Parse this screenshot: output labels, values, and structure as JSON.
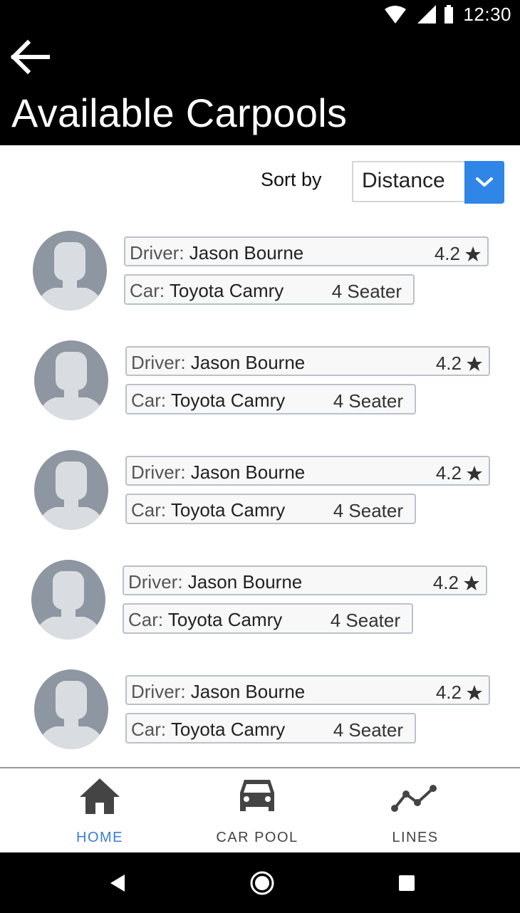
{
  "status_bar": {
    "time": "12:30",
    "icons": [
      "wifi-icon",
      "signal-icon",
      "battery-icon"
    ]
  },
  "app_bar": {
    "back_icon": "arrow-left-icon",
    "title": "Available Carpools"
  },
  "sort": {
    "label": "Sort by",
    "selected": "Distance",
    "accent_color": "#2f86e6"
  },
  "carpools": [
    {
      "driver_label": "Driver:",
      "driver": "Jason Bourne",
      "rating": "4.2",
      "car_label": "Car:",
      "car": "Toyota Camry",
      "seats": "4 Seater"
    },
    {
      "driver_label": "Driver:",
      "driver": "Jason Bourne",
      "rating": "4.2",
      "car_label": "Car:",
      "car": "Toyota Camry",
      "seats": "4 Seater"
    },
    {
      "driver_label": "Driver:",
      "driver": "Jason Bourne",
      "rating": "4.2",
      "car_label": "Car:",
      "car": "Toyota Camry",
      "seats": "4 Seater"
    },
    {
      "driver_label": "Driver:",
      "driver": "Jason Bourne",
      "rating": "4.2",
      "car_label": "Car:",
      "car": "Toyota Camry",
      "seats": "4 Seater"
    },
    {
      "driver_label": "Driver:",
      "driver": "Jason Bourne",
      "rating": "4.2",
      "car_label": "Car:",
      "car": "Toyota Camry",
      "seats": "4 Seater"
    }
  ],
  "bottom_nav": {
    "items": [
      {
        "label": "HOME",
        "icon": "home-icon",
        "active": true
      },
      {
        "label": "CAR POOL",
        "icon": "car-icon",
        "active": false
      },
      {
        "label": "LINES",
        "icon": "line-chart-icon",
        "active": false
      }
    ],
    "active_color": "#3b7dd8"
  },
  "system_nav": {
    "icons": [
      "back-triangle-icon",
      "home-circle-icon",
      "recents-square-icon"
    ]
  }
}
